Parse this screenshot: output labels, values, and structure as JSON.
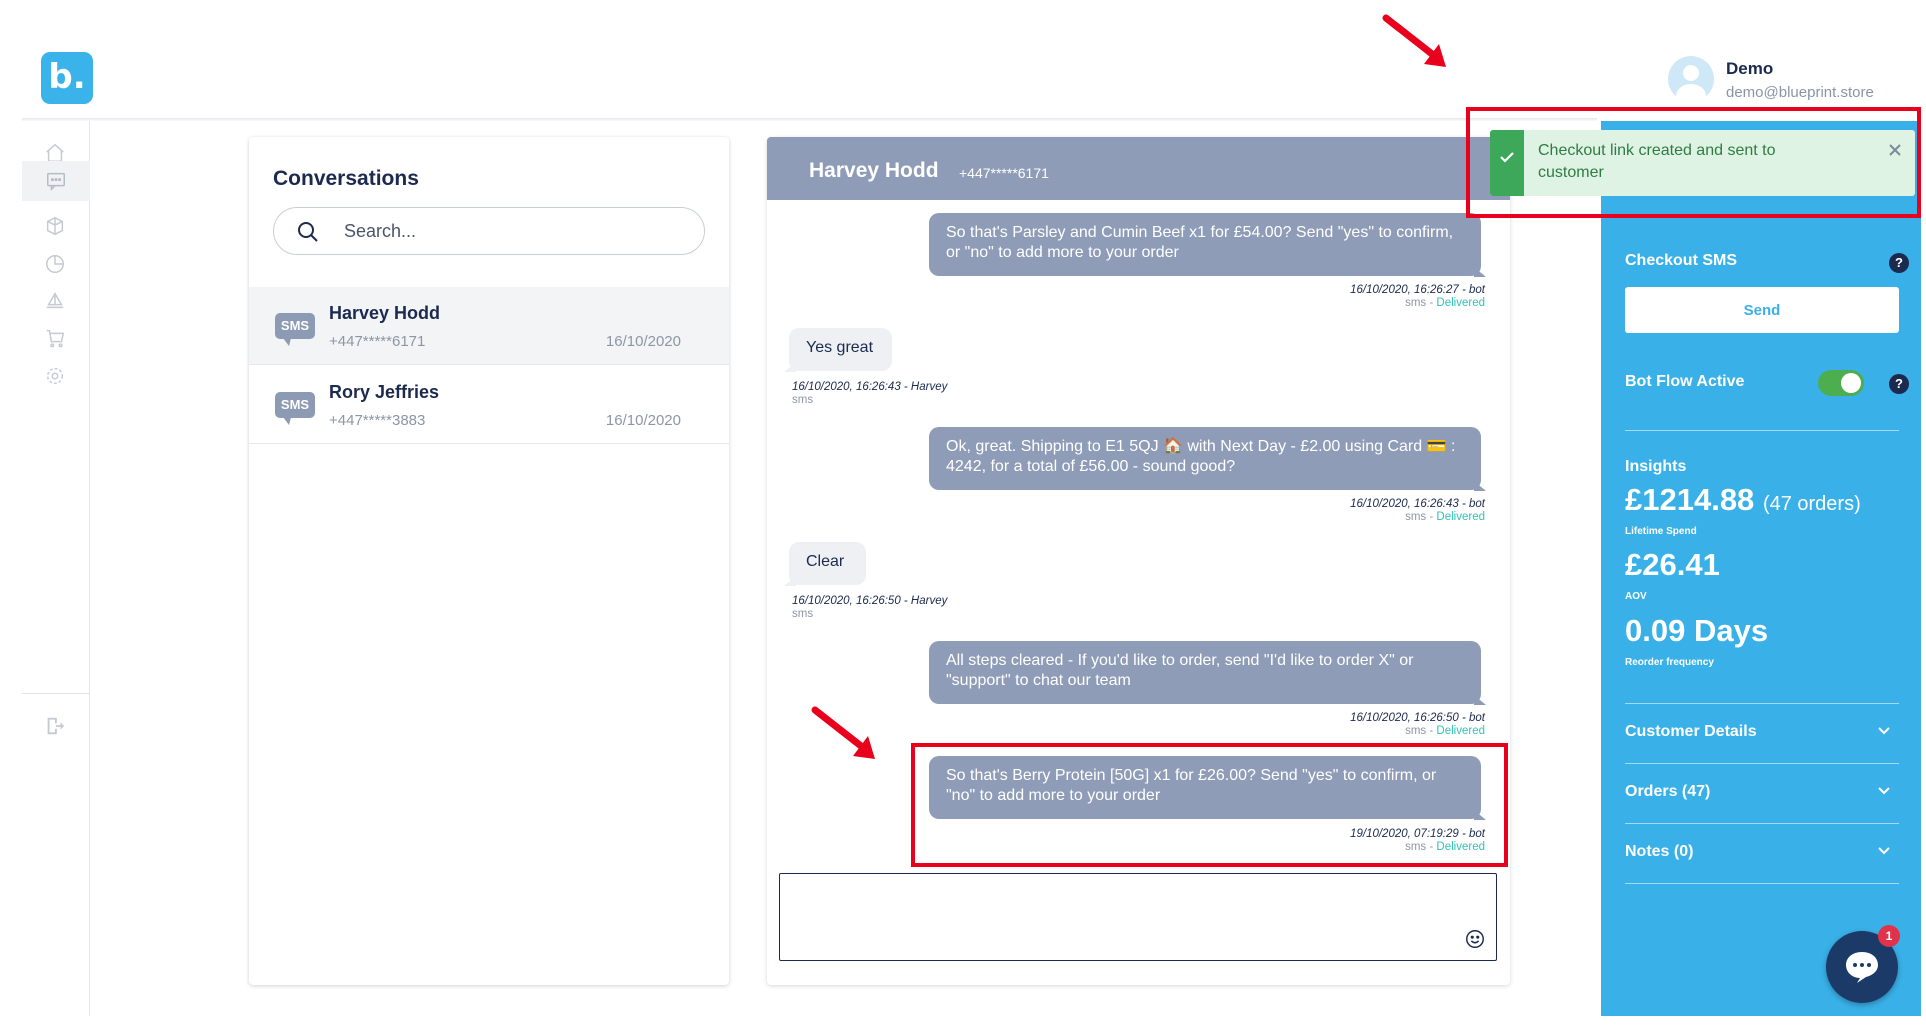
{
  "app": {
    "logo_text": "b."
  },
  "user": {
    "name": "Demo",
    "email": "demo@blueprint.store"
  },
  "sidebar": {
    "items": [
      {
        "icon": "home-icon"
      },
      {
        "icon": "chat-icon",
        "active": true
      },
      {
        "icon": "box-icon"
      },
      {
        "icon": "pie-chart-icon"
      },
      {
        "icon": "boat-icon"
      },
      {
        "icon": "cart-icon"
      },
      {
        "icon": "gear-icon"
      }
    ],
    "logout_icon": "logout-icon"
  },
  "conversations": {
    "title": "Conversations",
    "search_placeholder": "Search...",
    "items": [
      {
        "badge": "SMS",
        "name": "Harvey Hodd",
        "phone": "+447*****6171",
        "date": "16/10/2020",
        "active": true
      },
      {
        "badge": "SMS",
        "name": "Rory Jeffries",
        "phone": "+447*****3883",
        "date": "16/10/2020",
        "active": false
      }
    ]
  },
  "chat": {
    "header_name": "Harvey Hodd",
    "header_phone": "+447*****6171",
    "messages": [
      {
        "from": "bot",
        "text": "So that's Parsley and Cumin Beef x1 for £54.00? Send \"yes\" to confirm, or \"no\" to add more to your order",
        "time": "16/10/2020, 16:26:27 - bot",
        "channel": "sms",
        "sep": " - ",
        "status": "Delivered"
      },
      {
        "from": "user",
        "text": "Yes great",
        "time": "16/10/2020, 16:26:43 - Harvey",
        "channel": "sms"
      },
      {
        "from": "bot",
        "text": "Ok, great. Shipping to E1 5QJ 🏠  with Next Day - £2.00 using Card 💳 : 4242, for a total of £56.00 - sound good?",
        "time": "16/10/2020, 16:26:43 - bot",
        "channel": "sms",
        "sep": " - ",
        "status": "Delivered"
      },
      {
        "from": "user",
        "text": "Clear",
        "time": "16/10/2020, 16:26:50 - Harvey",
        "channel": "sms"
      },
      {
        "from": "bot",
        "text": "All steps cleared - If you'd like to order, send \"I'd like to order X\" or \"support\" to chat our team",
        "time": "16/10/2020, 16:26:50 - bot",
        "channel": "sms",
        "sep": " - ",
        "status": "Delivered"
      },
      {
        "from": "bot",
        "text": "So that's Berry Protein [50G] x1 for £26.00? Send \"yes\" to confirm, or \"no\" to add more to your order",
        "time": "19/10/2020, 07:19:29 - bot",
        "channel": "sms",
        "sep": " - ",
        "status": "Delivered"
      }
    ],
    "composer_value": ""
  },
  "toast": {
    "message": "Checkout link created and sent to customer",
    "icon": "check-icon"
  },
  "right_panel": {
    "checkout_sms_label": "Checkout SMS",
    "help": "?",
    "send_label": "Send",
    "bot_flow_label": "Bot Flow Active",
    "bot_flow_active": true,
    "insights_label": "Insights",
    "lifetime_spend_value": "£1214.88",
    "lifetime_spend_orders": "(47 orders)",
    "lifetime_spend_caption": "Lifetime Spend",
    "aov_value": "£26.41",
    "aov_caption": "AOV",
    "reorder_value": "0.09 Days",
    "reorder_caption": "Reorder frequency",
    "sections": [
      "Customer Details",
      "Orders (47)",
      "Notes (0)"
    ]
  },
  "chat_widget": {
    "badge_count": "1"
  },
  "colors": {
    "accent": "#39b1e8",
    "bot_bubble": "#8e9cb7",
    "navy": "#1b2a4e",
    "delivered": "#2ec4b6",
    "annotation": "#e8001c",
    "toast_green": "#3ea85a"
  }
}
